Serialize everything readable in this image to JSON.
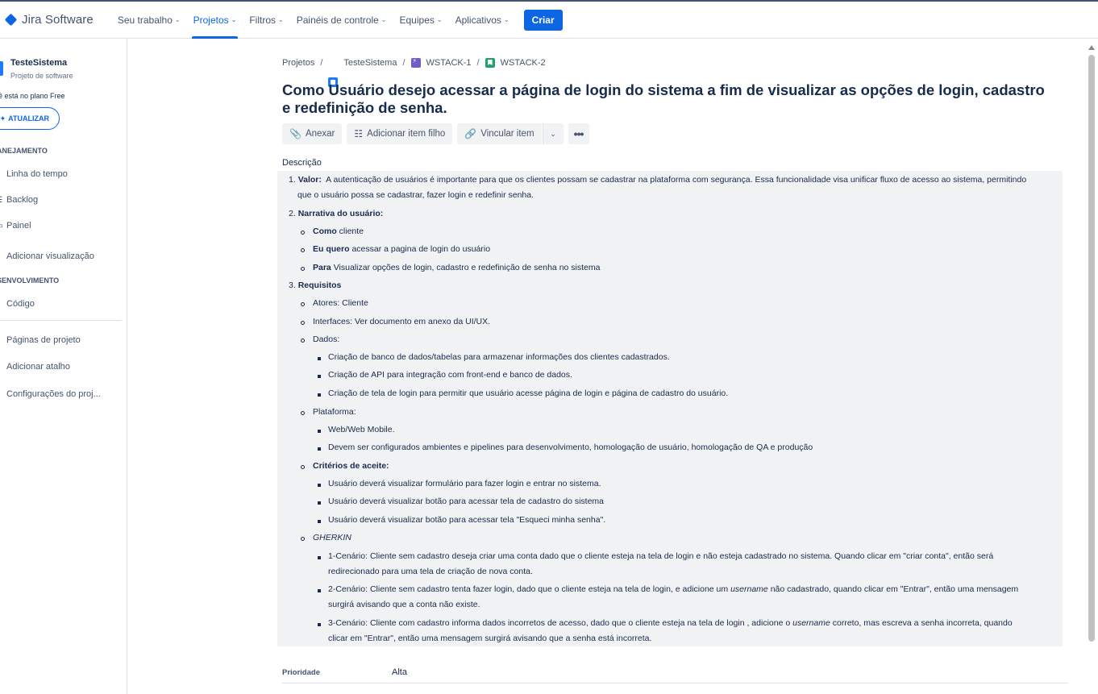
{
  "topnav": {
    "logo": "Jira Software",
    "items": [
      {
        "label": "Seu trabalho"
      },
      {
        "label": "Projetos"
      },
      {
        "label": "Filtros"
      },
      {
        "label": "Painéis de controle"
      },
      {
        "label": "Equipes"
      },
      {
        "label": "Aplicativos"
      }
    ],
    "create_label": "Criar"
  },
  "sidebar": {
    "project_name": "TesteSistema",
    "project_type": "Projeto de software",
    "plan_text": "ê está no plano Free",
    "upgrade_label": "ATUALIZAR",
    "section_planning": "ANEJAMENTO",
    "planning_items": [
      {
        "label": "Linha do tempo"
      },
      {
        "label": "Backlog"
      },
      {
        "label": "Painel"
      },
      {
        "label": "Adicionar visualização"
      }
    ],
    "section_dev": "SENVOLVIMENTO",
    "dev_items": [
      {
        "label": "Código"
      }
    ],
    "other_items": [
      {
        "label": "Páginas de projeto"
      },
      {
        "label": "Adicionar atalho"
      },
      {
        "label": "Configurações do proj..."
      }
    ]
  },
  "breadcrumb": {
    "root": "Projetos",
    "project": "TesteSistema",
    "epic": "WSTACK-1",
    "issue": "WSTACK-2"
  },
  "issue": {
    "title": "Como Usuário desejo acessar a página de login do sistema a fim de visualizar as opções de login, cadastro e redefinição de senha.",
    "actions": {
      "attach": "Anexar",
      "add_child": "Adicionar item filho",
      "link": "Vincular item"
    },
    "description_label": "Descrição",
    "description": {
      "l1_num": "1.",
      "l1_bold": "Valor:",
      "l1_text": "A autenticação de usuários é importante para que os clientes possam se cadastrar na plataforma com segurança. Essa funcionalidade visa unificar fluxo de acesso ao sistema, permitindo",
      "l1_text2": "que o usuário possa se cadastrar, fazer login e redefinir senha.",
      "l2_num": "2.",
      "l2_bold": "Narrativa do usuário:",
      "l2a_bold": "Como",
      "l2a_text": "cliente",
      "l2b_bold": "Eu quero",
      "l2b_text": "acessar a pagina de login do usuário",
      "l2c_bold": "Para",
      "l2c_text": "Visualizar opções de login, cadastro e redefinição de senha no sistema",
      "l3_num": "3.",
      "l3_bold": "Requisitos",
      "r1": "Atores: Cliente",
      "r2": "Interfaces: Ver documento em anexo da UI/UX.",
      "r3": "Dados:",
      "r3a": "Criação de banco de dados/tabelas para armazenar informações dos clientes cadastrados.",
      "r3b": "Criação de API para integração com front-end e banco de dados.",
      "r3c": "Criação de tela de login para permitir que usuário acesse página de login e página de cadastro do usuário.",
      "r4": "Plataforma:",
      "r4a": "Web/Web Mobile.",
      "r4b": "Devem ser configurados ambientes e pipelines para desenvolvimento, homologação de usuário, homologação de QA e produção",
      "r5": "Critérios de aceite:",
      "r5a": "Usuário deverá visualizar formulário para fazer login e entrar no sistema.",
      "r5b": "Usuário deverá visualizar botão para acessar tela de cadastro do sistema",
      "r5c": "Usuário deverá visualizar botão para acessar tela \"Esqueci minha senha\".",
      "r6": "GHERKIN",
      "g1": "1-Cenário: Cliente sem cadastro deseja criar uma conta dado que o cliente esteja na tela de login e não esteja cadastrado no sistema. Quando clicar em \"criar conta\", então será",
      "g1b": "redirecionado para uma tela de criação de nova conta.",
      "g2_pre": "2-Cenário: Cliente sem cadastro tenta fazer login, dado que o cliente esteja na tela de login, e adicione um",
      "g2_it": "username",
      "g2_post": "não cadastrado, quando clicar em \"Entrar\", então uma mensagem",
      "g2b": "surgirá avisando que a conta não existe.",
      "g3_pre": "3-Cenário: Cliente com cadastro informa dados incorretos de acesso, dado que o cliente esteja na tela de login , adicione o",
      "g3_it": "username",
      "g3_post": "correto, mas escreva a senha incorreta, quando",
      "g3b": "clicar em \"Entrar\", então uma mensagem surgirá avisando que a senha está incorreta."
    },
    "priority_label": "Prioridade",
    "priority_value": "Alta"
  }
}
